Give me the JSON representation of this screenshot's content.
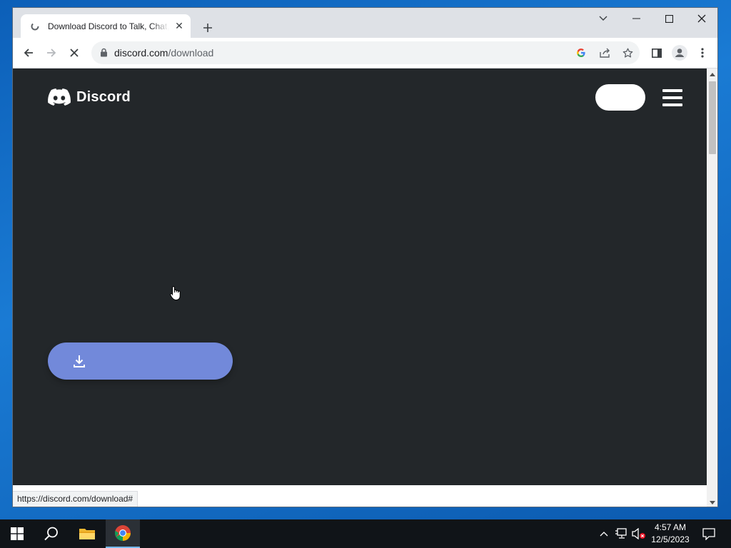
{
  "browser": {
    "tab": {
      "title": "Download Discord to Talk, Chat, and Hang Out"
    },
    "address_bar": {
      "domain": "discord.com",
      "path": "/download"
    },
    "status_url": "https://discord.com/download#"
  },
  "page": {
    "brand": {
      "wordmark": "Discord",
      "color": "#5865f2"
    },
    "background": "#23272a",
    "download_button_color": "#7289da"
  },
  "taskbar": {
    "time": "4:57 AM",
    "date": "12/5/2023"
  },
  "icons": {
    "back": "arrow-left-icon",
    "forward": "arrow-right-icon",
    "stop": "close-icon",
    "lock": "lock-icon",
    "google": "google-icon",
    "share": "share-icon",
    "bookmark": "star-icon",
    "side_panel": "side-panel-icon",
    "profile": "profile-icon",
    "menu": "kebab-menu-icon",
    "download": "download-icon",
    "start": "windows-start-icon",
    "search": "search-icon",
    "explorer": "folder-icon",
    "chrome": "chrome-icon"
  }
}
